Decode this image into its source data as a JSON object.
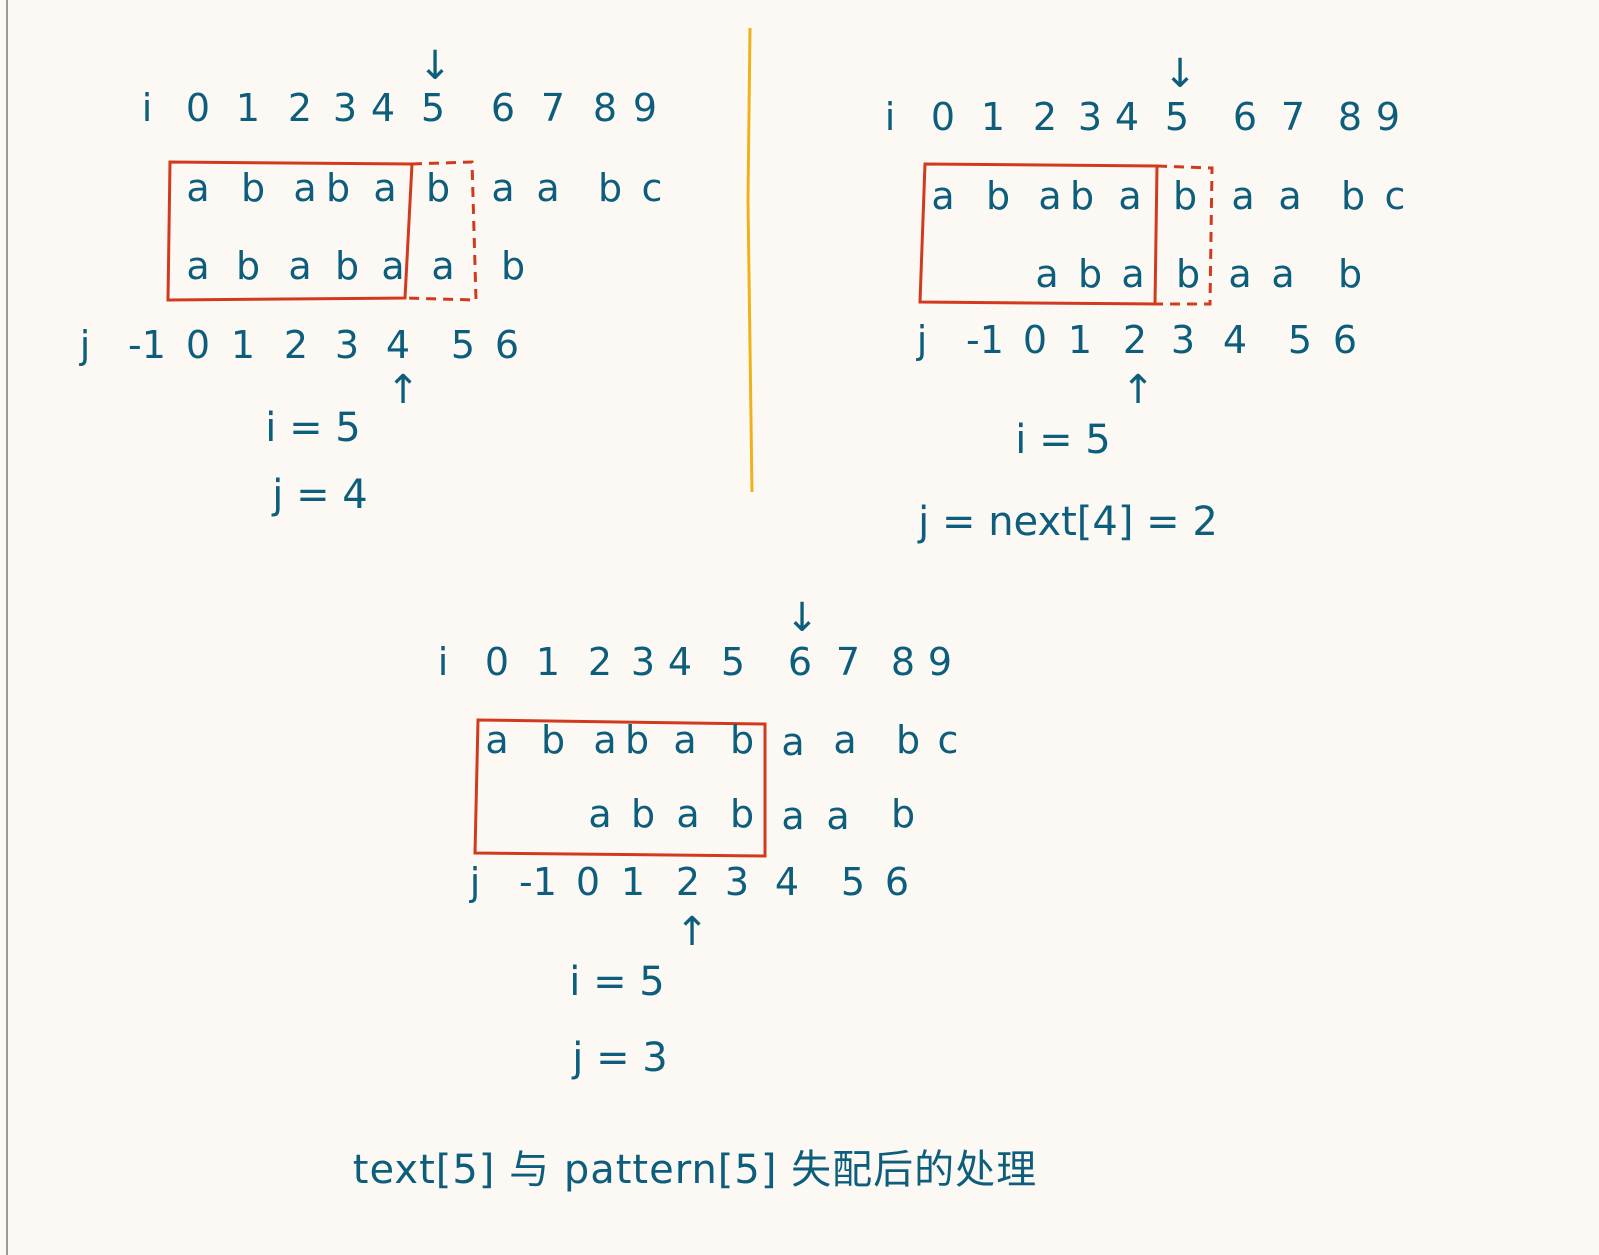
{
  "panel1": {
    "i_label": "i",
    "i_indices": [
      "0",
      "1",
      "2",
      "3",
      "4",
      "5",
      "6",
      "7",
      "8",
      "9"
    ],
    "text_chars": [
      "a",
      "b",
      "a",
      "b",
      "a",
      "b",
      "a",
      "a",
      "b",
      "c"
    ],
    "pattern_chars": [
      "a",
      "b",
      "a",
      "b",
      "a",
      "a",
      "b"
    ],
    "j_label": "j",
    "j_indices": [
      "-1",
      "0",
      "1",
      "2",
      "3",
      "4",
      "5",
      "6"
    ],
    "top_arrow": "↓",
    "bottom_arrow": "↑",
    "i_value": "i = 5",
    "j_value": "j = 4"
  },
  "panel2": {
    "i_label": "i",
    "i_indices": [
      "0",
      "1",
      "2",
      "3",
      "4",
      "5",
      "6",
      "7",
      "8",
      "9"
    ],
    "text_chars": [
      "a",
      "b",
      "a",
      "b",
      "a",
      "b",
      "a",
      "a",
      "b",
      "c"
    ],
    "pattern_chars": [
      "a",
      "b",
      "a",
      "b",
      "a",
      "a",
      "b"
    ],
    "j_label": "j",
    "j_indices": [
      "-1",
      "0",
      "1",
      "2",
      "3",
      "4",
      "5",
      "6"
    ],
    "top_arrow": "↓",
    "bottom_arrow": "↑",
    "i_value": "i = 5",
    "j_value": "j = next[4] = 2"
  },
  "panel3": {
    "i_label": "i",
    "i_indices": [
      "0",
      "1",
      "2",
      "3",
      "4",
      "5",
      "6",
      "7",
      "8",
      "9"
    ],
    "text_chars": [
      "a",
      "b",
      "a",
      "b",
      "a",
      "b",
      "a",
      "a",
      "b",
      "c"
    ],
    "pattern_chars": [
      "a",
      "b",
      "a",
      "b",
      "a",
      "a",
      "b"
    ],
    "j_label": "j",
    "j_indices": [
      "-1",
      "0",
      "1",
      "2",
      "3",
      "4",
      "5",
      "6"
    ],
    "top_arrow": "↓",
    "bottom_arrow": "↑",
    "i_value": "i = 5",
    "j_value": "j = 3"
  },
  "caption": "text[5] 与 pattern[5] 失配后的处理",
  "colors": {
    "ink": "#0d5e7c",
    "box": "#d23a1e",
    "divider": "#f0b21a",
    "paper": "#fcf9f4"
  }
}
